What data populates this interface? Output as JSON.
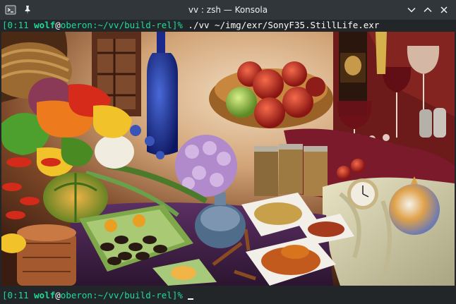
{
  "window": {
    "title": "vv : zsh — Konsola"
  },
  "terminal": {
    "line1": {
      "time": "[0:11 ",
      "user": "wolf",
      "at": "@",
      "host": "oberon",
      "path": ":~/vv/build-rel",
      "bracket": "]%",
      "command": " ./vv ~/img/exr/SonyF35.StillLife.exr"
    },
    "line2": {
      "time": "[0:11 ",
      "user": "wolf",
      "at": "@",
      "host": "oberon",
      "path": ":~/vv/build-rel",
      "bracket": "]%",
      "command": " "
    }
  },
  "colors": {
    "prompt": "#1cdc9a",
    "text": "#fcfcfc",
    "background": "#232629",
    "titlebar": "#31363b"
  },
  "icons": [
    "konsole-icon",
    "pin-icon",
    "chevron-down-icon",
    "chevron-up-icon",
    "close-icon"
  ],
  "image": {
    "description_icon": "still-life-photo"
  }
}
